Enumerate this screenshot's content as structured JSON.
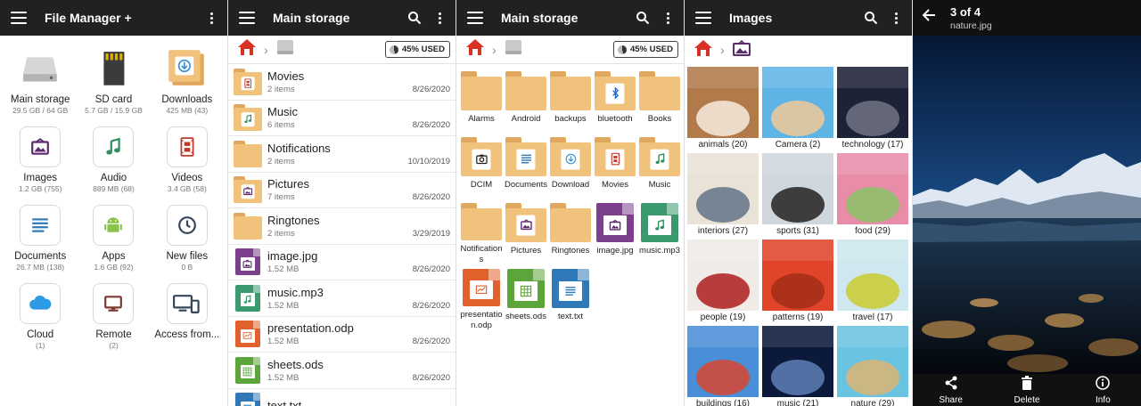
{
  "home": {
    "title": "File Manager +",
    "tiles": [
      {
        "label": "Main storage",
        "sub": "29.5 GB / 64 GB",
        "icon": "drive-icon"
      },
      {
        "label": "SD card",
        "sub": "5.7 GB / 15.9 GB",
        "icon": "sd-card-icon"
      },
      {
        "label": "Downloads",
        "sub": "425 MB (43)",
        "icon": "downloads-folder-icon"
      },
      {
        "label": "Images",
        "sub": "1.2 GB (755)",
        "icon": "image-icon"
      },
      {
        "label": "Audio",
        "sub": "889 MB (68)",
        "icon": "music-note-icon"
      },
      {
        "label": "Videos",
        "sub": "3.4 GB (58)",
        "icon": "film-icon"
      },
      {
        "label": "Documents",
        "sub": "26.7 MB (138)",
        "icon": "document-icon"
      },
      {
        "label": "Apps",
        "sub": "1.6 GB (92)",
        "icon": "android-icon"
      },
      {
        "label": "New files",
        "sub": "0 B",
        "icon": "clock-icon"
      },
      {
        "label": "Cloud",
        "sub": "(1)",
        "icon": "cloud-icon"
      },
      {
        "label": "Remote",
        "sub": "(2)",
        "icon": "monitor-icon"
      },
      {
        "label": "Access from...",
        "sub": "",
        "icon": "devices-icon"
      }
    ]
  },
  "list_view": {
    "title": "Main storage",
    "used": "45% USED",
    "used_fraction": 0.45,
    "rows": [
      {
        "name": "Movies",
        "sub": "2 items",
        "date": "8/26/2020",
        "kind": "folder",
        "badge": "film-icon"
      },
      {
        "name": "Music",
        "sub": "6 items",
        "date": "8/26/2020",
        "kind": "folder",
        "badge": "music-note-icon"
      },
      {
        "name": "Notifications",
        "sub": "2 items",
        "date": "10/10/2019",
        "kind": "folder",
        "badge": ""
      },
      {
        "name": "Pictures",
        "sub": "7 items",
        "date": "8/26/2020",
        "kind": "folder",
        "badge": "image-icon"
      },
      {
        "name": "Ringtones",
        "sub": "2 items",
        "date": "3/29/2019",
        "kind": "folder",
        "badge": ""
      },
      {
        "name": "image.jpg",
        "sub": "1.52 MB",
        "date": "8/26/2020",
        "kind": "file",
        "color": "#7b3f8c",
        "badge": "image-icon"
      },
      {
        "name": "music.mp3",
        "sub": "1.52 MB",
        "date": "8/26/2020",
        "kind": "file",
        "color": "#3a9a6e",
        "badge": "music-note-icon"
      },
      {
        "name": "presentation.odp",
        "sub": "1.52 MB",
        "date": "8/26/2020",
        "kind": "file",
        "color": "#e0612b",
        "badge": "chart-icon"
      },
      {
        "name": "sheets.ods",
        "sub": "1.52 MB",
        "date": "8/26/2020",
        "kind": "file",
        "color": "#5ca53a",
        "badge": "table-icon"
      },
      {
        "name": "text.txt",
        "sub": "",
        "date": "",
        "kind": "file",
        "color": "#2f79b8",
        "badge": "document-icon"
      }
    ]
  },
  "grid_view": {
    "title": "Main storage",
    "used": "45% USED",
    "items": [
      {
        "name": "Alarms",
        "kind": "folder",
        "badge": ""
      },
      {
        "name": "Android",
        "kind": "folder",
        "badge": ""
      },
      {
        "name": "backups",
        "kind": "folder",
        "badge": ""
      },
      {
        "name": "bluetooth",
        "kind": "folder",
        "badge": "bluetooth-icon"
      },
      {
        "name": "Books",
        "kind": "folder",
        "badge": ""
      },
      {
        "name": "DCIM",
        "kind": "folder",
        "badge": "camera-icon"
      },
      {
        "name": "Documents",
        "kind": "folder",
        "badge": "document-icon"
      },
      {
        "name": "Download",
        "kind": "folder",
        "badge": "download-icon"
      },
      {
        "name": "Movies",
        "kind": "folder",
        "badge": "film-icon"
      },
      {
        "name": "Music",
        "kind": "folder",
        "badge": "music-note-icon"
      },
      {
        "name": "Notifications",
        "kind": "folder",
        "badge": ""
      },
      {
        "name": "Pictures",
        "kind": "folder",
        "badge": "image-icon"
      },
      {
        "name": "Ringtones",
        "kind": "folder",
        "badge": ""
      },
      {
        "name": "image.jpg",
        "kind": "file",
        "color": "#7b3f8c",
        "badge": "image-icon"
      },
      {
        "name": "music.mp3",
        "kind": "file",
        "color": "#3a9a6e",
        "badge": "music-note-icon"
      },
      {
        "name": "presentation.odp",
        "kind": "file",
        "color": "#e0612b",
        "badge": "chart-icon"
      },
      {
        "name": "sheets.ods",
        "kind": "file",
        "color": "#5ca53a",
        "badge": "table-icon"
      },
      {
        "name": "text.txt",
        "kind": "file",
        "color": "#2f79b8",
        "badge": "document-icon"
      }
    ]
  },
  "images": {
    "title": "Images",
    "albums": [
      {
        "caption": "animals (20)",
        "palette": [
          "#b27a4a",
          "#f2e6d6"
        ]
      },
      {
        "caption": "Camera (2)",
        "palette": [
          "#5fb4e6",
          "#e8c89a"
        ]
      },
      {
        "caption": "technology (17)",
        "palette": [
          "#1d2236",
          "#6b6f80"
        ]
      },
      {
        "caption": "interiors (27)",
        "palette": [
          "#e9e2d6",
          "#6a7a8c"
        ]
      },
      {
        "caption": "sports (31)",
        "palette": [
          "#cfd6dc",
          "#2c2c2c"
        ]
      },
      {
        "caption": "food (29)",
        "palette": [
          "#e88ca8",
          "#8fc06a"
        ]
      },
      {
        "caption": "people (19)",
        "palette": [
          "#f0ebe6",
          "#b02a2a"
        ]
      },
      {
        "caption": "patterns (19)",
        "palette": [
          "#e0452a",
          "#a52f1a"
        ]
      },
      {
        "caption": "travel (17)",
        "palette": [
          "#cfe8f0",
          "#c9cc3a"
        ]
      },
      {
        "caption": "buildings (16)",
        "palette": [
          "#4a8ed8",
          "#d24a3a"
        ]
      },
      {
        "caption": "music (21)",
        "palette": [
          "#0b1a3a",
          "#5a7ab0"
        ]
      },
      {
        "caption": "nature (29)",
        "palette": [
          "#6ac3e0",
          "#d6b67a"
        ]
      }
    ]
  },
  "viewer": {
    "counter": "3 of 4",
    "filename": "nature.jpg",
    "actions": [
      {
        "label": "Share",
        "icon": "share-icon"
      },
      {
        "label": "Delete",
        "icon": "trash-icon"
      },
      {
        "label": "Info",
        "icon": "info-icon"
      }
    ]
  },
  "colors": {
    "appbar": "#212121",
    "folder": "#f0c27b",
    "folder_tab": "#e0a85e",
    "home_red": "#d93025"
  }
}
